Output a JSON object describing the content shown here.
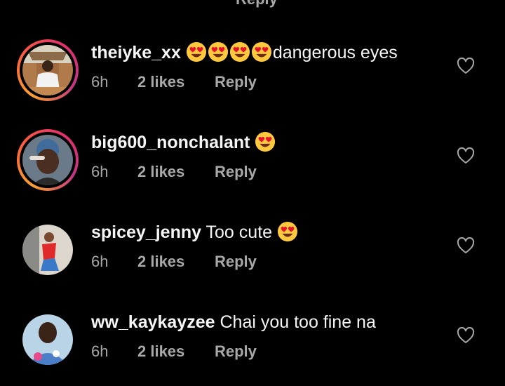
{
  "top_cut_text": "Reply",
  "like_button_icon": "heart-outline-icon",
  "comments": [
    {
      "username": "theiyke_xx",
      "text": "dangerous eyes",
      "emoji_count": 4,
      "emoji": "heart-eyes-emoji",
      "time": "6h",
      "likes": "2 likes",
      "reply": "Reply",
      "story_ring": true
    },
    {
      "username": "big600_nonchalant",
      "text": "",
      "emoji_count": 1,
      "emoji": "heart-eyes-emoji",
      "time": "6h",
      "likes": "2 likes",
      "reply": "Reply",
      "story_ring": true
    },
    {
      "username": "spicey_jenny",
      "text": "Too cute",
      "emoji_count": 1,
      "emoji": "heart-eyes-emoji",
      "time": "6h",
      "likes": "2 likes",
      "reply": "Reply",
      "story_ring": false
    },
    {
      "username": "ww_kaykayzee",
      "text": "Chai you too fine na",
      "emoji_count": 0,
      "time": "6h",
      "likes": "2 likes",
      "reply": "Reply",
      "story_ring": false
    }
  ]
}
